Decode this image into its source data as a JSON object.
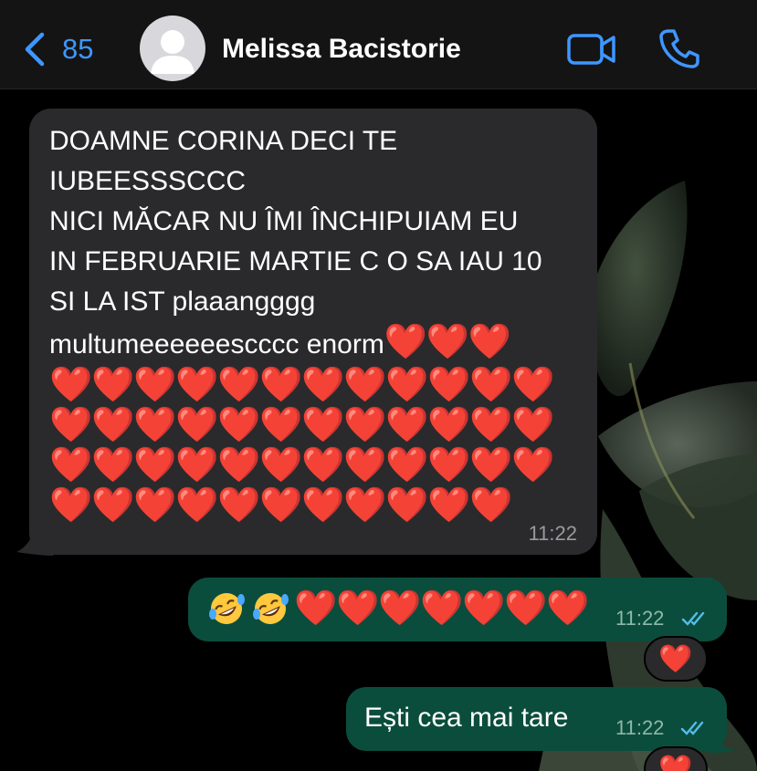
{
  "header": {
    "back_count": "85",
    "contact_name": "Melissa Bacistorie",
    "icons": [
      "chevron-left-icon",
      "avatar-placeholder-icon",
      "video-call-icon",
      "phone-call-icon"
    ],
    "accent_color": "#3e97ff"
  },
  "messages": {
    "incoming": {
      "text": "DOAMNE CORINA DECI TE\nIUBEESSSCCC\nNICI MĂCAR NU ÎMI ÎNCHIPUIAM EU\nIN FEBRUARIE MARTIE C O SA IAU 10\nSI LA IST plaaangggg\nmultumeeeeeescccc enorm",
      "heart": "❤️",
      "time": "11:22"
    },
    "outgoing_1": {
      "laugh_emoji": "🤣",
      "heart": "❤️",
      "time": "11:22",
      "reaction": "❤️"
    },
    "outgoing_2": {
      "text": "Ești cea mai tare",
      "time": "11:22",
      "reaction": "❤️"
    }
  },
  "colors": {
    "incoming_bubble": "#2a2a2c",
    "outgoing_bubble": "#0b4d3c",
    "heart": "#ff1a1a",
    "read_ticks": "#53bdeb"
  }
}
